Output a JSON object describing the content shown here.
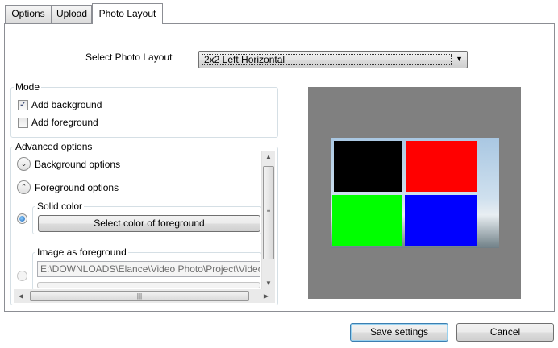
{
  "tabs": [
    {
      "label": "Options"
    },
    {
      "label": "Upload"
    },
    {
      "label": "Photo Layout"
    }
  ],
  "layout": {
    "select_label": "Select Photo Layout",
    "selected_value": "2x2 Left Horizontal"
  },
  "mode": {
    "title": "Mode",
    "add_background": {
      "label": "Add background",
      "checked": true
    },
    "add_foreground": {
      "label": "Add foreground",
      "checked": false
    }
  },
  "advanced": {
    "title": "Advanced options",
    "background_options": "Background options",
    "foreground_options": "Foreground options",
    "solid_color": {
      "title": "Solid color",
      "button_label": "Select color of foreground"
    },
    "image_foreground": {
      "title": "Image as foreground",
      "path": "E:\\DOWNLOADS\\Elance\\Video Photo\\Project\\Video"
    }
  },
  "preview": {
    "cells": [
      {
        "name": "top-left",
        "color": "#000000"
      },
      {
        "name": "top-right",
        "color": "#ff0000"
      },
      {
        "name": "bottom-left",
        "color": "#00ff00"
      },
      {
        "name": "bottom-right",
        "color": "#0000ff"
      }
    ],
    "background_color": "#808080"
  },
  "footer": {
    "save_label": "Save settings",
    "cancel_label": "Cancel"
  }
}
